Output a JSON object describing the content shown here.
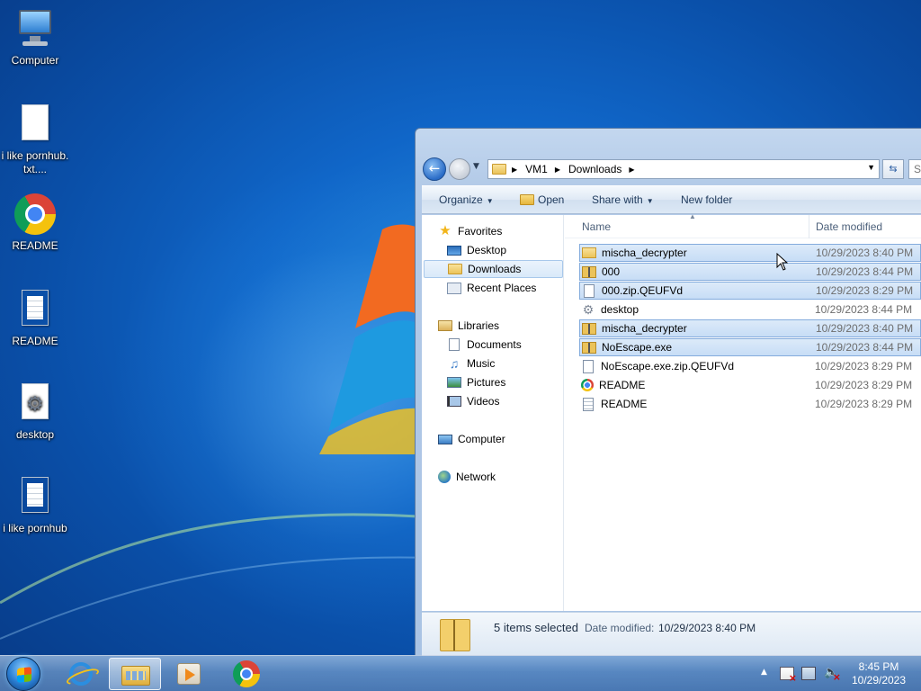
{
  "desktop": {
    "icons": [
      {
        "label": "Computer"
      },
      {
        "label": "i like pornhub.txt...."
      },
      {
        "label": "README"
      },
      {
        "label": "README"
      },
      {
        "label": "desktop"
      },
      {
        "label": "i like pornhub"
      }
    ]
  },
  "explorer": {
    "address": {
      "crumbs": [
        "VM1",
        "Downloads"
      ],
      "search_placeholder": "S"
    },
    "toolbar": {
      "organize": "Organize",
      "open": "Open",
      "share_with": "Share with",
      "new_folder": "New folder"
    },
    "nav": {
      "favorites": "Favorites",
      "desktop": "Desktop",
      "downloads": "Downloads",
      "recent_places": "Recent Places",
      "libraries": "Libraries",
      "documents": "Documents",
      "music": "Music",
      "pictures": "Pictures",
      "videos": "Videos",
      "computer": "Computer",
      "network": "Network"
    },
    "columns": {
      "name": "Name",
      "date_modified": "Date modified"
    },
    "files": [
      {
        "name": "mischa_decrypter",
        "date": "10/29/2023 8:40 PM",
        "icon": "folder-icon",
        "selected": true
      },
      {
        "name": "000",
        "date": "10/29/2023 8:44 PM",
        "icon": "zip-folder-icon",
        "selected": true
      },
      {
        "name": "000.zip.QEUFVd",
        "date": "10/29/2023 8:29 PM",
        "icon": "blank-file-icon",
        "selected": true
      },
      {
        "name": "desktop",
        "date": "10/29/2023 8:44 PM",
        "icon": "gear-file-icon",
        "selected": false
      },
      {
        "name": "mischa_decrypter",
        "date": "10/29/2023 8:40 PM",
        "icon": "zip-folder-icon",
        "selected": true
      },
      {
        "name": "NoEscape.exe",
        "date": "10/29/2023 8:44 PM",
        "icon": "zip-folder-icon",
        "selected": true
      },
      {
        "name": "NoEscape.exe.zip.QEUFVd",
        "date": "10/29/2023 8:29 PM",
        "icon": "blank-file-icon",
        "selected": false
      },
      {
        "name": "README",
        "date": "10/29/2023 8:29 PM",
        "icon": "chrome-icon",
        "selected": false
      },
      {
        "name": "README",
        "date": "10/29/2023 8:29 PM",
        "icon": "text-file-icon",
        "selected": false
      }
    ],
    "details": {
      "count": "5 items selected",
      "date_label": "Date modified:",
      "date_value": "10/29/2023 8:40 PM"
    }
  },
  "taskbar": {
    "clock_time": "8:45 PM",
    "clock_date": "10/29/2023"
  }
}
